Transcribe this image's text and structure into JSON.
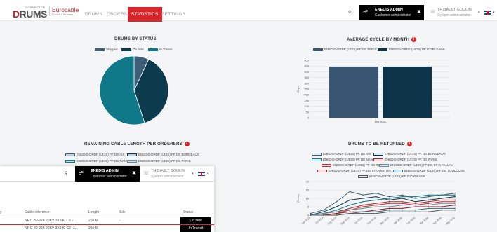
{
  "header": {
    "logo_small": "CONNECTED",
    "logo_main_red": "D",
    "logo_main_grey": "RUMS",
    "brand_name": "Eurocable",
    "brand_tagline": "Powers & Business",
    "nav": [
      "DRUMS",
      "ORDERS",
      "STATISTICS",
      "SETTINGS"
    ],
    "active_nav": "STATISTICS",
    "account": {
      "name": "ENEDIS ADMIN",
      "role": "Customer administrator"
    },
    "user": {
      "name": "THIBAULT GOULIN",
      "role": "System administrator"
    }
  },
  "colors": {
    "accent": "#d8262c",
    "pie_dark_teal": "#1a5a6d",
    "pie_teal": "#0f7889",
    "pie_grey": "#3f5e78",
    "bar_blue": "#385572",
    "bar_navy": "#0d3348"
  },
  "cards": {
    "drums_by_status": {
      "title": "DRUMS BY STATUS",
      "legend": [
        "Shipped",
        "On field",
        "In Transit"
      ]
    },
    "average_cycle": {
      "title": "AVERAGE CYCLE BY MONTH",
      "legend": [
        "ENEDIS-DRDF (UCIS) PF DE PARIS",
        "ENEDIS-DRDF (UCIS) PF D'ORLEANS"
      ],
      "y_label": "Days"
    },
    "remaining_cable": {
      "title": "REMAINING CABLE LENGTH PER ORDERERS",
      "legend": [
        "ENEDIS-DRDF (UCIS) PF DE AIX",
        "ENEDIS-DRDF (UCIS) PF DE BORDEAUX",
        "ENEDIS-DRDF (UCIS) PF DE NANCY",
        "ENEDIS-DRDF (UCIS) PF DE PARIS"
      ]
    },
    "drums_to_return": {
      "title": "DRUMS TO BE RETURNED",
      "legend": [
        "ENEDIS-DRDF (UCIS) PF DE AIX",
        "ENEDIS-DRDF (UCIS) PF DE BORDEAUX",
        "ENEDIS-DRDF (UCIS) PF DE NANCY",
        "ENEDIS-DRDF (UCIS) PF DE PARIS",
        "ENEDIS-DRDF (UCIS) PF DE RIOM",
        "ENEDIS-DRDF (UCIS) PF DE ST G.FALLAV",
        "ENEDIS-DRDF (UCIS) PF DE ST QUENTIN",
        "ENEDIS-DRDF (UCIS) PF DE TOULOUSE",
        "ENEDIS-DRDF (UCIS) PF D'ORLEANS"
      ],
      "y_label": "Drums"
    }
  },
  "chart_data": [
    {
      "type": "pie",
      "title": "DRUMS BY STATUS",
      "categories": [
        "Shipped",
        "On field",
        "In Transit"
      ],
      "values": [
        7,
        38,
        55
      ],
      "colors": [
        "#3f5e78",
        "#0b3b4d",
        "#0f7889"
      ]
    },
    {
      "type": "bar",
      "title": "AVERAGE CYCLE BY MONTH",
      "categories": [
        "Mai 2020"
      ],
      "series": [
        {
          "name": "ENEDIS-DRDF (UCIS) PF DE PARIS",
          "values": [
            445
          ],
          "color": "#385572"
        },
        {
          "name": "ENEDIS-DRDF (UCIS) PF D'ORLEANS",
          "values": [
            445
          ],
          "color": "#0d3348"
        }
      ],
      "ylabel": "Days",
      "ylim": [
        0,
        500
      ],
      "yticks": [
        0,
        50,
        100,
        150,
        200,
        250,
        300,
        350,
        400,
        450,
        500
      ]
    },
    {
      "type": "line",
      "title": "DRUMS TO BE RETURNED",
      "x": [
        "Jun 2019",
        "Jul 2019",
        "Aug 2019",
        "Sep 2019",
        "Oct 2019",
        "Nov 2019",
        "Dec 2019",
        "Jan 2020",
        "Feb 2020",
        "Mar 2020",
        "Apr 2020",
        "May 2020"
      ],
      "ylabel": "Drums",
      "ylim": [
        0,
        20
      ],
      "yticks": [
        0,
        5,
        10,
        15,
        20
      ],
      "series": [
        {
          "values": [
            1,
            3,
            8,
            14,
            12,
            13,
            11,
            12,
            10,
            11,
            12,
            13
          ],
          "color": "#3f5e78"
        },
        {
          "values": [
            0,
            2,
            5,
            9,
            10,
            11,
            9,
            10,
            8,
            9,
            10,
            11
          ],
          "color": "#0d3348"
        },
        {
          "values": [
            0,
            1,
            3,
            6,
            8,
            9,
            10,
            11,
            11,
            12,
            12,
            12
          ],
          "color": "#0f7889"
        },
        {
          "values": [
            0,
            1,
            2,
            4,
            6,
            7,
            8,
            8,
            7,
            8,
            9,
            9
          ],
          "color": "#a52a2a"
        },
        {
          "values": [
            0,
            0,
            1,
            3,
            5,
            6,
            7,
            7,
            6,
            7,
            8,
            8
          ],
          "color": "#d8262c"
        },
        {
          "values": [
            0,
            1,
            2,
            3,
            4,
            5,
            5,
            6,
            6,
            6,
            7,
            7
          ],
          "color": "#6a8aa5"
        },
        {
          "values": [
            0,
            0,
            1,
            2,
            2,
            3,
            4,
            4,
            5,
            5,
            5,
            6
          ],
          "color": "#8b1e1e"
        },
        {
          "values": [
            0,
            0,
            0,
            1,
            2,
            2,
            3,
            3,
            3,
            4,
            4,
            4
          ],
          "color": "#2f6f7f"
        },
        {
          "values": [
            0,
            0,
            0,
            1,
            1,
            1,
            2,
            2,
            2,
            2,
            3,
            3
          ],
          "color": "#555555"
        }
      ]
    }
  ],
  "overlay": {
    "account": {
      "name": "ENEDIS ADMIN",
      "role": "Customer administrator"
    },
    "user": {
      "name": "THIBAULT GOULIN",
      "role": "System administrator"
    },
    "columns": [
      "Cable reference",
      "Length",
      "Site",
      "Status"
    ],
    "rows": [
      {
        "ref": "NF C 33-226 20KV 3X240 C2 -1...",
        "length": "250 M",
        "site": "-",
        "status": "On field"
      },
      {
        "ref": "NF C 33-226 20KV 3X240 C2 -1...",
        "length": "250 M",
        "site": "-",
        "status": "In Transit"
      }
    ]
  }
}
